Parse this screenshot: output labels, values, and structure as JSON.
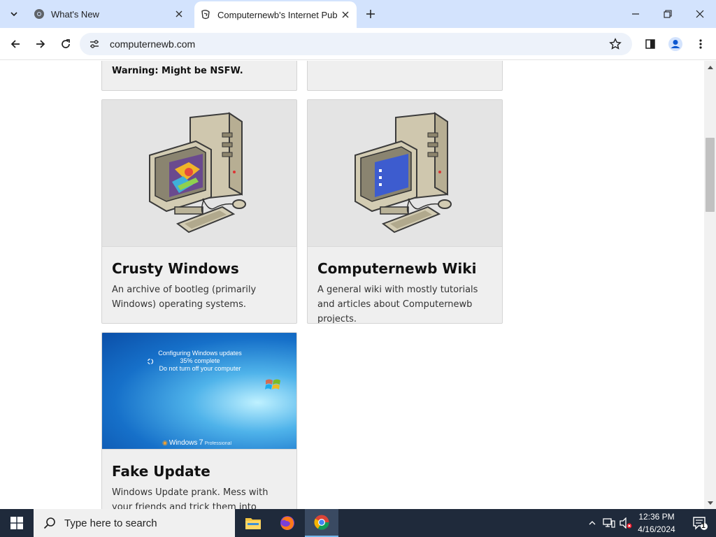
{
  "browser": {
    "tabs": [
      {
        "title": "What's New",
        "active": false
      },
      {
        "title": "Computernewb's Internet Pub",
        "active": true
      }
    ],
    "url": "computernewb.com"
  },
  "page": {
    "partial_card": {
      "warning": "Warning: Might be NSFW."
    },
    "cards": [
      {
        "title": "Crusty Windows",
        "description": "An archive of bootleg (primarily Windows) operating systems.",
        "image": "retro-computer-colorful-screen"
      },
      {
        "title": "Computernewb Wiki",
        "description": "A general wiki with mostly tutorials and articles about Computernewb projects.",
        "image": "retro-computer-blue-screen"
      },
      {
        "title": "Fake Update",
        "description": "Windows Update prank. Mess with your friends and trick them into thinking their",
        "image": "windows-7-update-screen"
      }
    ],
    "update_screen": {
      "line1": "Configuring Windows updates",
      "line2": "35% complete",
      "line3": "Do not turn off your computer",
      "brand": "Windows",
      "brand_version": "7",
      "brand_edition": "Professional"
    }
  },
  "taskbar": {
    "search_placeholder": "Type here to search",
    "time": "12:36 PM",
    "date": "4/16/2024",
    "notification_count": "1"
  },
  "colors": {
    "tabstrip": "#d3e3fd",
    "taskbar": "#1f2a3b",
    "card_bg": "#efefef"
  }
}
